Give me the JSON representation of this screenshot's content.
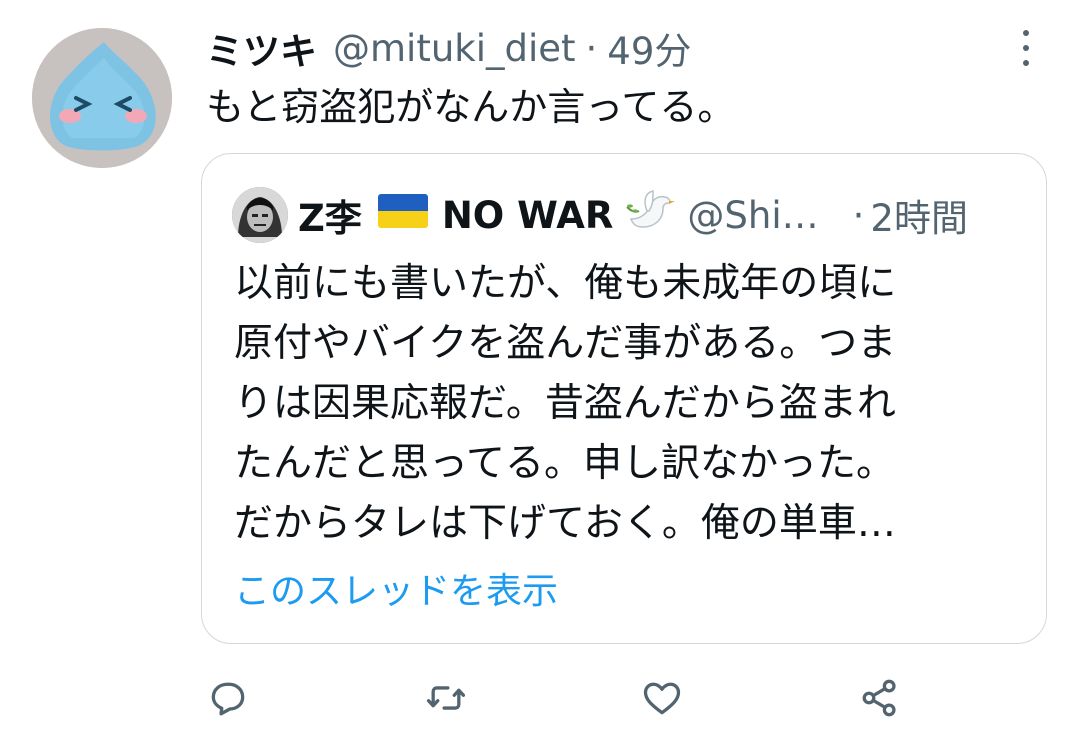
{
  "tweet": {
    "author_name": "ミツキ",
    "author_handle": "@mituki_diet",
    "separator": "·",
    "time": "49分",
    "text": "もと窃盗犯がなんか言ってる。"
  },
  "quote": {
    "author_name": "Z李",
    "author_name_suffix": "NO WAR",
    "author_handle": "@Shi…",
    "separator": "·",
    "time": "2時間",
    "lines": [
      "以前にも書いたが、俺も未成年の頃に",
      "原付やバイクを盗んだ事がある。つま",
      "りは因果応報だ。昔盗んだから盗まれ",
      "たんだと思ってる。申し訳なかった。",
      "だからタレは下げておく。俺の単車…"
    ],
    "show_thread_label": "このスレッドを表示"
  },
  "icons": {
    "more": "more-vertical-icon",
    "reply": "reply-icon",
    "retweet": "retweet-icon",
    "like": "heart-icon",
    "share": "share-icon"
  },
  "colors": {
    "accent": "#1d9bf0",
    "secondary_text": "#536471",
    "border": "#cfd9de",
    "flag_blue": "#1f5fbf",
    "flag_yellow": "#f7d117"
  }
}
